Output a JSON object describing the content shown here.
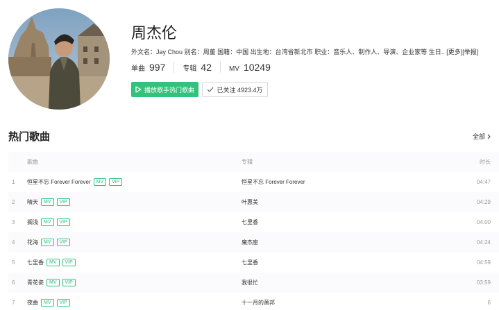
{
  "artist": {
    "name": "周杰伦",
    "info": {
      "foreign_name_label": "外文名：",
      "foreign_name": "Jay Chou",
      "alias_label": "别名：",
      "alias": "周董",
      "nationality_label": "国籍：",
      "nationality": "中国",
      "birthplace_label": "出生地：",
      "birthplace": "台湾省新北市",
      "occupation_label": "职业：",
      "occupation": "音乐人、制作人、导演、企业家等",
      "birthday_label": "生日..",
      "more_label": "[更多]",
      "report_label": "[举报]"
    },
    "stats": [
      {
        "label": "单曲",
        "value": "997"
      },
      {
        "label": "专辑",
        "value": "42"
      },
      {
        "label": "MV",
        "value": "10249"
      }
    ],
    "play_button": "播放歌手热门歌曲",
    "follow_button": "已关注 4923.4万"
  },
  "section": {
    "title": "热门歌曲",
    "all_label": "全部"
  },
  "table": {
    "headers": {
      "song": "歌曲",
      "album": "专辑",
      "duration": "时长"
    },
    "tags": {
      "mv": "MV",
      "vip": "VIP"
    },
    "rows": [
      {
        "index": "1",
        "song": "恒星不忘 Forever Forever",
        "album": "恒星不忘 Forever Forever",
        "duration": "04:47"
      },
      {
        "index": "2",
        "song": "晴天",
        "album": "叶惠美",
        "duration": "04:29"
      },
      {
        "index": "3",
        "song": "搁浅",
        "album": "七里香",
        "duration": "04:00"
      },
      {
        "index": "4",
        "song": "花海",
        "album": "魔杰座",
        "duration": "04:24"
      },
      {
        "index": "5",
        "song": "七里香",
        "album": "七里香",
        "duration": "04:59"
      },
      {
        "index": "6",
        "song": "青花瓷",
        "album": "我很忙",
        "duration": "03:59"
      },
      {
        "index": "7",
        "song": "夜曲",
        "album": "十一月的萧邦",
        "duration": "6"
      }
    ]
  },
  "colors": {
    "accent": "#31c27c",
    "text": "#333333",
    "muted": "#999999"
  }
}
